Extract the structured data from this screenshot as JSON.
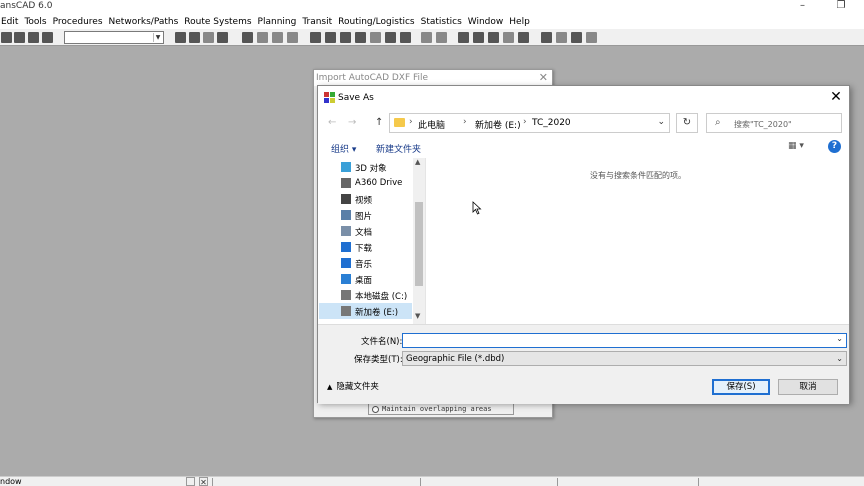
{
  "app": {
    "title": "ansCAD 6.0",
    "menu": [
      "Edit",
      "Tools",
      "Procedures",
      "Networks/Paths",
      "Route Systems",
      "Planning",
      "Transit",
      "Routing/Logistics",
      "Statistics",
      "Window",
      "Help"
    ],
    "status_text": "ndow"
  },
  "import_dialog": {
    "title": "Import AutoCAD DXF File",
    "close_glyph": "✕",
    "maintain_label": "Maintain overlapping areas"
  },
  "save_as": {
    "title": "Save As",
    "close_glyph": "✕",
    "nav": {
      "back": "←",
      "forward": "→",
      "up": "↑",
      "refresh": "↻"
    },
    "breadcrumb": [
      "此电脑",
      "新加卷 (E:)",
      "TC_2020"
    ],
    "search_placeholder": "搜索\"TC_2020\"",
    "organize_label": "组织 ▾",
    "new_folder_label": "新建文件夹",
    "view_label": "▦ ▾",
    "help_glyph": "?",
    "tree": [
      {
        "label": "3D 对象",
        "icon": "3d-objects-icon",
        "color": "#3aa0d8"
      },
      {
        "label": "A360 Drive",
        "icon": "cloud-drive-icon",
        "color": "#666666"
      },
      {
        "label": "视频",
        "icon": "video-icon",
        "color": "#444444"
      },
      {
        "label": "图片",
        "icon": "pictures-icon",
        "color": "#5a7fa8"
      },
      {
        "label": "文档",
        "icon": "documents-icon",
        "color": "#7a8fa8"
      },
      {
        "label": "下载",
        "icon": "downloads-icon",
        "color": "#1f6fd1"
      },
      {
        "label": "音乐",
        "icon": "music-icon",
        "color": "#1f6fd1"
      },
      {
        "label": "桌面",
        "icon": "desktop-icon",
        "color": "#2a7fd4"
      },
      {
        "label": "本地磁盘 (C:)",
        "icon": "local-disk-icon",
        "color": "#777777"
      },
      {
        "label": "新加卷 (E:)",
        "icon": "volume-icon",
        "color": "#777777",
        "selected": true
      }
    ],
    "empty_message": "没有与搜索条件匹配的项。",
    "filename_label": "文件名(N):",
    "filename_value": "",
    "filetype_label": "保存类型(T):",
    "filetype_value": "Geographic File (*.dbd)",
    "hide_folders_label": "隐藏文件夹",
    "save_label": "保存(S)",
    "cancel_label": "取消"
  }
}
